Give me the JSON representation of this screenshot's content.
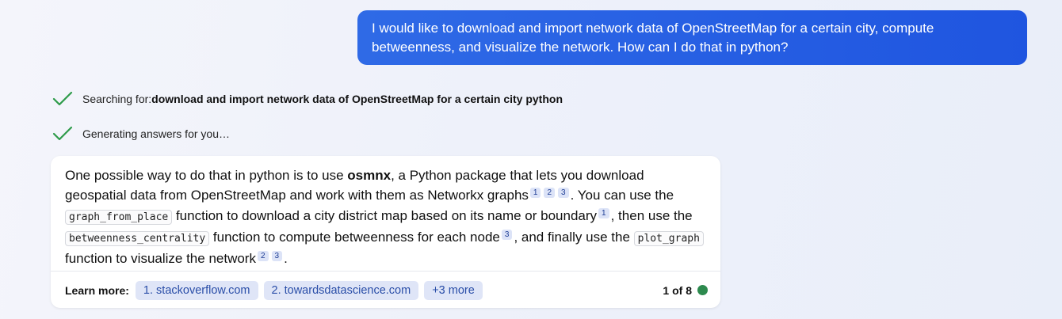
{
  "user_message": {
    "text": "I would like to download and import network data of OpenStreetMap for a certain city, compute betweenness, and visualize the network. How can I do that in python?"
  },
  "status": [
    {
      "icon": "checkmark-icon",
      "prefix": "Searching for: ",
      "bold": "download and import network data of OpenStreetMap for a certain city python"
    },
    {
      "icon": "checkmark-icon",
      "prefix": "Generating answers for you…",
      "bold": ""
    }
  ],
  "answer": {
    "p1": "One possible way to do that in python is to use ",
    "bold1": "osmnx",
    "p2": ", a Python package that lets you download geospatial data from OpenStreetMap and work with them as Networkx graphs",
    "cites1": [
      "1",
      "2",
      "3"
    ],
    "p3": ". You can use the ",
    "code1": "graph_from_place",
    "p4": " function to download a city district map based on its name or boundary",
    "cites2": [
      "1"
    ],
    "p5": ", then use the ",
    "code2": "betweenness_centrality",
    "p6": " function to compute betweenness for each node",
    "cites3": [
      "3"
    ],
    "p7": ", and finally use the ",
    "code3": "plot_graph",
    "p8": " function to visualize the network",
    "cites4": [
      "2",
      "3"
    ],
    "p9": "."
  },
  "learn_more": {
    "label": "Learn more:",
    "links": [
      "1. stackoverflow.com",
      "2. towardsdatascience.com",
      "+3 more"
    ],
    "counter": "1 of 8"
  },
  "colors": {
    "accent": "#2f6ae6",
    "check": "#2e9b4a",
    "status_dot": "#2d8a4e"
  }
}
